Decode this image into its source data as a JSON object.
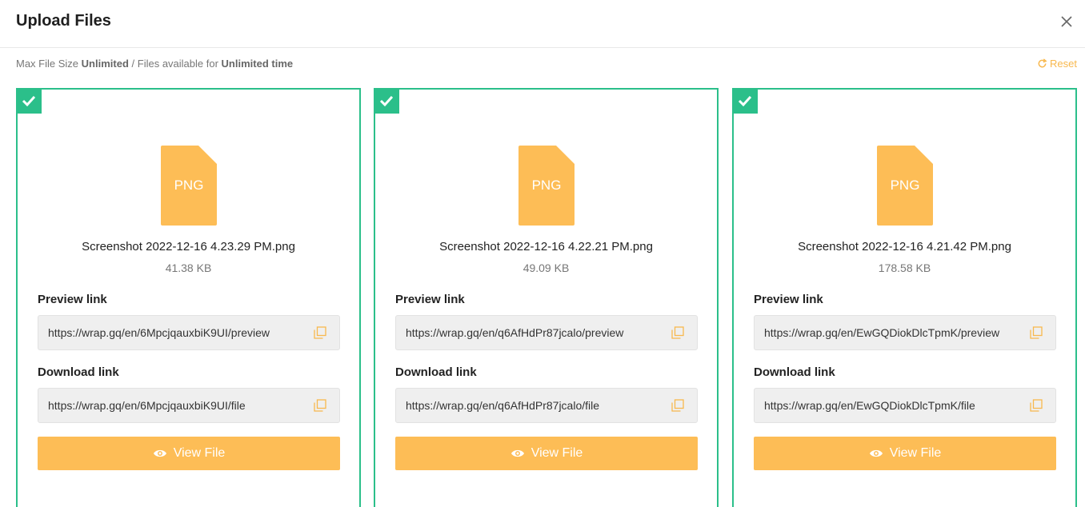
{
  "header": {
    "title": "Upload Files"
  },
  "info": {
    "max_size_label": "Max File Size",
    "max_size_value": "Unlimited",
    "separator": "/",
    "available_label": "Files available for",
    "available_value": "Unlimited time"
  },
  "reset_label": "Reset",
  "colors": {
    "accent": "#2bbf8a",
    "primary": "#fdbd56",
    "icon": "#fdbd56"
  },
  "files": [
    {
      "type": "PNG",
      "name": "Screenshot 2022-12-16 4.23.29 PM.png",
      "size": "41.38 KB",
      "preview_label": "Preview link",
      "preview_url": "https://wrap.gq/en/6MpcjqauxbiK9UI/preview",
      "download_label": "Download link",
      "download_url": "https://wrap.gq/en/6MpcjqauxbiK9UI/file",
      "view_label": "View File"
    },
    {
      "type": "PNG",
      "name": "Screenshot 2022-12-16 4.22.21 PM.png",
      "size": "49.09 KB",
      "preview_label": "Preview link",
      "preview_url": "https://wrap.gq/en/q6AfHdPr87jcalo/preview",
      "download_label": "Download link",
      "download_url": "https://wrap.gq/en/q6AfHdPr87jcalo/file",
      "view_label": "View File"
    },
    {
      "type": "PNG",
      "name": "Screenshot 2022-12-16 4.21.42 PM.png",
      "size": "178.58 KB",
      "preview_label": "Preview link",
      "preview_url": "https://wrap.gq/en/EwGQDiokDlcTpmK/preview",
      "download_label": "Download link",
      "download_url": "https://wrap.gq/en/EwGQDiokDlcTpmK/file",
      "view_label": "View File"
    }
  ]
}
